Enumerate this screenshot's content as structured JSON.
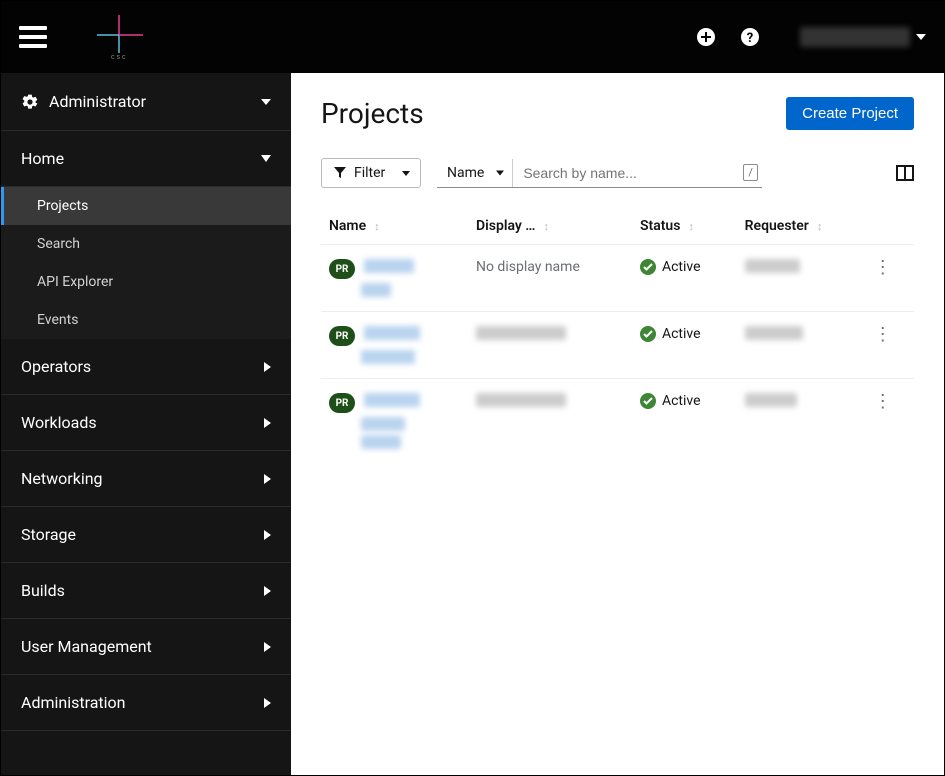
{
  "topbar": {
    "logo_text": "csc"
  },
  "perspective": {
    "label": "Administrator"
  },
  "sidebar": {
    "home_label": "Home",
    "home_items": [
      "Projects",
      "Search",
      "API Explorer",
      "Events"
    ],
    "groups": [
      "Operators",
      "Workloads",
      "Networking",
      "Storage",
      "Builds",
      "User Management",
      "Administration"
    ]
  },
  "page": {
    "title": "Projects",
    "create_btn": "Create Project"
  },
  "toolbar": {
    "filter_label": "Filter",
    "name_dropdown": "Name",
    "search_placeholder": "Search by name...",
    "slash_hint": "/"
  },
  "columns": {
    "name": "Name",
    "display": "Display …",
    "status": "Status",
    "requester": "Requester"
  },
  "badge": "PR",
  "status_active": "Active",
  "no_display": "No display name",
  "rows": [
    {
      "display_is_empty": true
    },
    {
      "display_is_empty": false
    },
    {
      "display_is_empty": false
    }
  ]
}
